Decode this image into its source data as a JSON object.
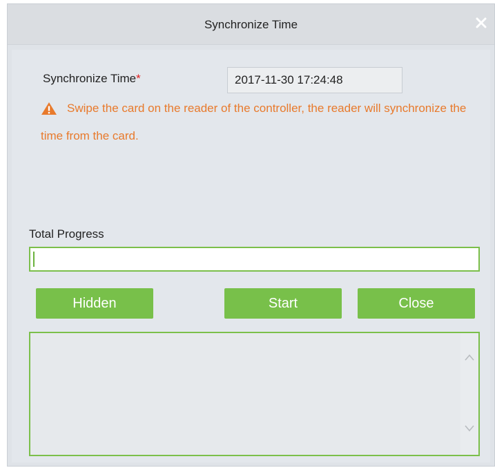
{
  "dialog": {
    "title": "Synchronize Time",
    "close_icon": "close-icon"
  },
  "form": {
    "time_label": "Synchronize Time",
    "required_mark": "*",
    "time_value": "2017-11-30 17:24:48"
  },
  "warning": {
    "icon": "warning-icon",
    "text": "Swipe the card on the reader of the controller, the reader will synchronize the time from the card."
  },
  "progress": {
    "label": "Total Progress",
    "value_percent": 0
  },
  "buttons": {
    "hidden": "Hidden",
    "start": "Start",
    "close": "Close"
  },
  "log": {
    "scroll_up_icon": "chevron-up-icon",
    "scroll_down_icon": "chevron-down-icon"
  },
  "colors": {
    "accent_green": "#78c04a",
    "warning_orange": "#e87a2c",
    "required_red": "#e02020"
  }
}
